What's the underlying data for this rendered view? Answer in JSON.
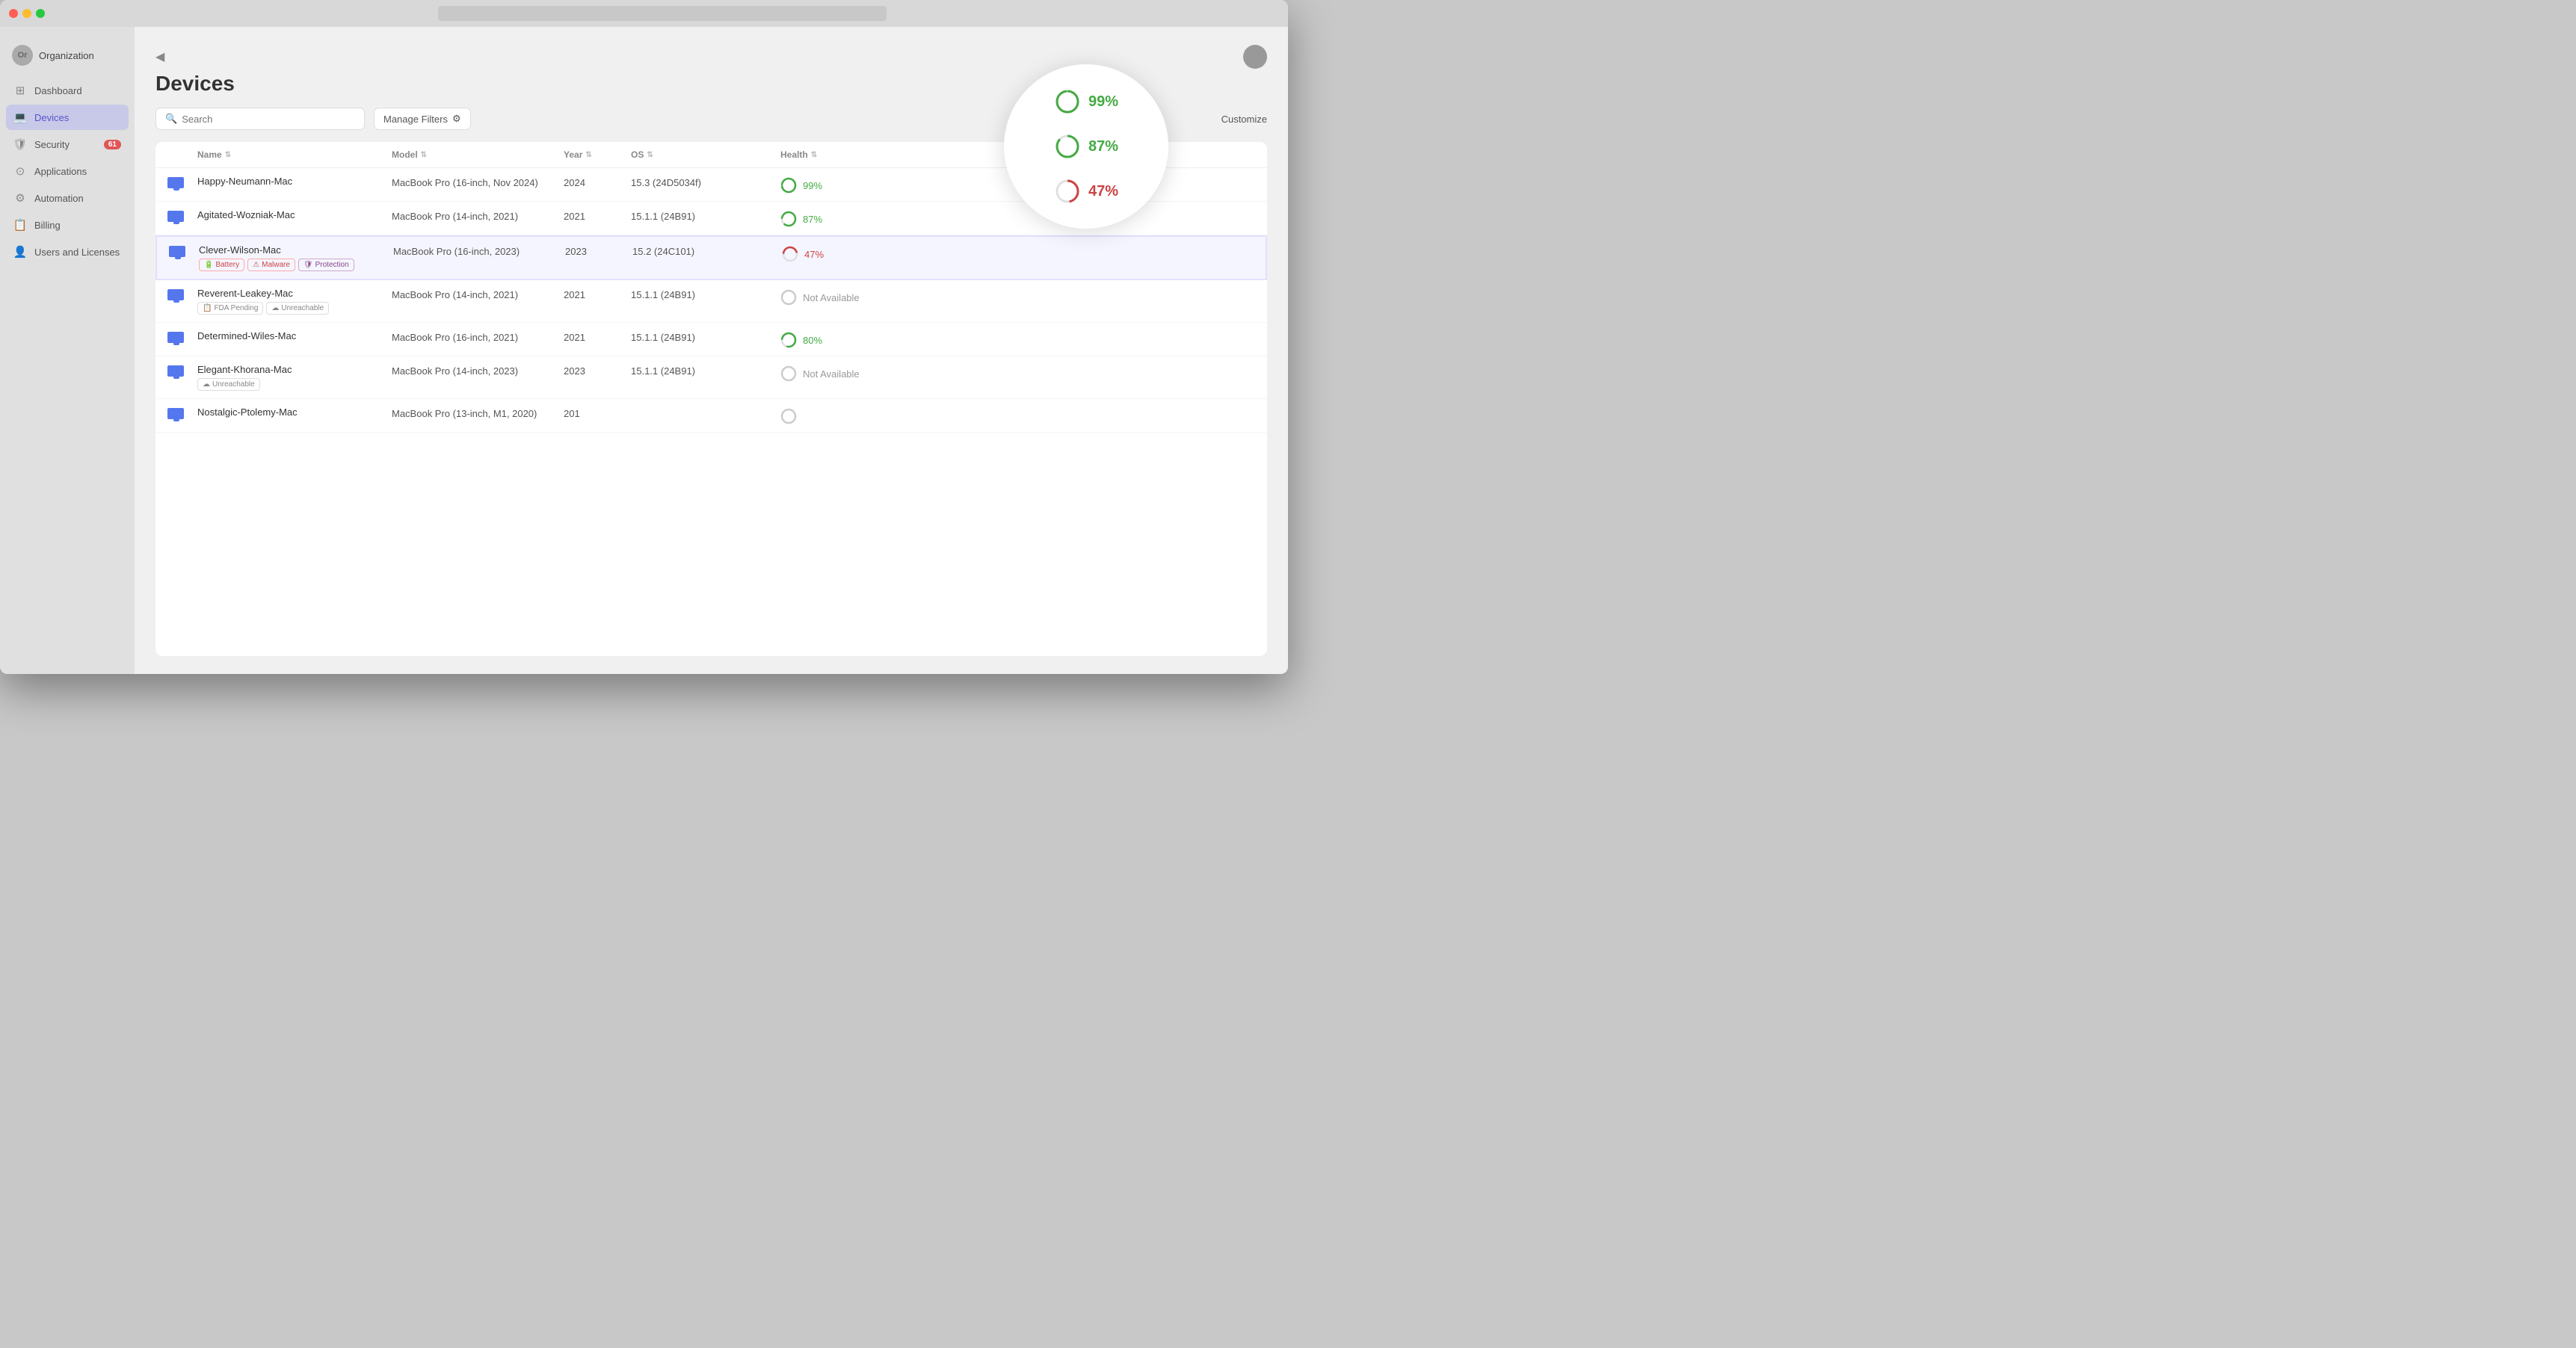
{
  "window": {
    "title": ""
  },
  "sidebar": {
    "org_label": "Organization",
    "org_initials": "Or",
    "collapse_icon": "◀",
    "items": [
      {
        "id": "dashboard",
        "label": "Dashboard",
        "icon": "⊞",
        "active": false,
        "badge": null
      },
      {
        "id": "devices",
        "label": "Devices",
        "icon": "💻",
        "active": true,
        "badge": null
      },
      {
        "id": "security",
        "label": "Security",
        "icon": "🛡",
        "active": false,
        "badge": "61"
      },
      {
        "id": "applications",
        "label": "Applications",
        "icon": "⊙",
        "active": false,
        "badge": null
      },
      {
        "id": "automation",
        "label": "Automation",
        "icon": "⚙",
        "active": false,
        "badge": null
      },
      {
        "id": "billing",
        "label": "Billing",
        "icon": "📋",
        "active": false,
        "badge": null
      },
      {
        "id": "users-and-licenses",
        "label": "Users and Licenses",
        "icon": "👤",
        "active": false,
        "badge": null
      }
    ]
  },
  "page": {
    "title": "Devices",
    "search_placeholder": "Search",
    "manage_filters_label": "Manage Filters",
    "customize_label": "Customize"
  },
  "table": {
    "columns": [
      {
        "id": "icon",
        "label": ""
      },
      {
        "id": "name",
        "label": "Name"
      },
      {
        "id": "model",
        "label": "Model"
      },
      {
        "id": "year",
        "label": "Year"
      },
      {
        "id": "os",
        "label": "OS"
      },
      {
        "id": "health",
        "label": "Health"
      }
    ],
    "rows": [
      {
        "name": "Happy-Neumann-Mac",
        "model": "MacBook Pro (16-inch, Nov 2024)",
        "year": "2024",
        "os": "15.3 (24D5034f)",
        "health_value": "99%",
        "health_status": "green",
        "health_ring_color": "#44aa44",
        "tags": [],
        "selected": false
      },
      {
        "name": "Agitated-Wozniak-Mac",
        "model": "MacBook Pro (14-inch, 2021)",
        "year": "2021",
        "os": "15.1.1 (24B91)",
        "health_value": "87%",
        "health_status": "green",
        "health_ring_color": "#44aa44",
        "tags": [],
        "selected": false
      },
      {
        "name": "Clever-Wilson-Mac",
        "model": "MacBook Pro (16-inch, 2023)",
        "year": "2023",
        "os": "15.2 (24C101)",
        "health_value": "47%",
        "health_status": "red",
        "health_ring_color": "#cc4444",
        "tags": [
          {
            "type": "battery",
            "label": "Battery"
          },
          {
            "type": "malware",
            "label": "Malware"
          },
          {
            "type": "protection",
            "label": "Protection"
          }
        ],
        "selected": true
      },
      {
        "name": "Reverent-Leakey-Mac",
        "model": "MacBook Pro (14-inch, 2021)",
        "year": "2021",
        "os": "15.1.1 (24B91)",
        "health_value": "Not Available",
        "health_status": "gray",
        "health_ring_color": "#cccccc",
        "tags": [
          {
            "type": "fda",
            "label": "FDA Pending"
          },
          {
            "type": "unreachable",
            "label": "Unreachable"
          }
        ],
        "selected": false
      },
      {
        "name": "Determined-Wiles-Mac",
        "model": "MacBook Pro (16-inch, 2021)",
        "year": "2021",
        "os": "15.1.1 (24B91)",
        "health_value": "80%",
        "health_status": "green",
        "health_ring_color": "#44aa44",
        "tags": [],
        "selected": false
      },
      {
        "name": "Elegant-Khorana-Mac",
        "model": "MacBook Pro (14-inch, 2023)",
        "year": "2023",
        "os": "15.1.1 (24B91)",
        "health_value": "Not Available",
        "health_status": "gray",
        "health_ring_color": "#cccccc",
        "tags": [
          {
            "type": "unreachable",
            "label": "Unreachable"
          }
        ],
        "selected": false
      },
      {
        "name": "Nostalgic-Ptolemy-Mac",
        "model": "MacBook Pro (13-inch, M1, 2020)",
        "year": "201",
        "os": "",
        "health_value": "",
        "health_status": "gray",
        "health_ring_color": "#cccccc",
        "tags": [],
        "selected": false
      }
    ]
  },
  "spotlight": {
    "rows": [
      {
        "value": "99%",
        "status": "green",
        "ring_color": "#44aa44",
        "ring_pct": 99
      },
      {
        "value": "87%",
        "status": "green",
        "ring_color": "#44aa44",
        "ring_pct": 87
      },
      {
        "value": "47%",
        "status": "red",
        "ring_color": "#cc4444",
        "ring_pct": 47
      }
    ]
  },
  "icons": {
    "search": "🔍",
    "filter": "⚙",
    "sort": "⇅",
    "battery": "🔋",
    "malware": "⚠",
    "protection": "🛡",
    "fda": "📋",
    "unreachable": "☁",
    "collapse": "◀"
  }
}
